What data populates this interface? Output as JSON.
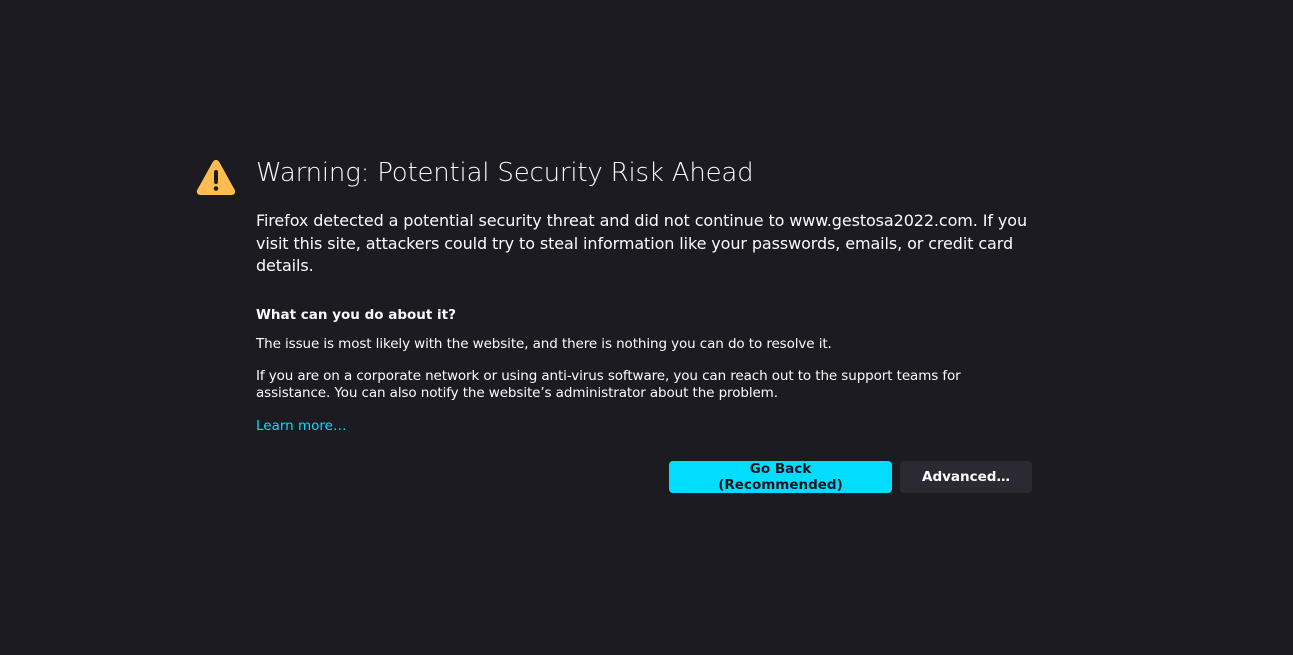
{
  "page": {
    "title": "Warning: Potential Security Risk Ahead",
    "intro": "Firefox detected a potential security threat and did not continue to www.gestosa2022.com. If you visit this site, attackers could try to steal information like your passwords, emails, or credit card details.",
    "subheading": "What can you do about it?",
    "paragraph_1": "The issue is most likely with the website, and there is nothing you can do to resolve it.",
    "paragraph_2": "If you are on a corporate network or using anti-virus software, you can reach out to the support teams for assistance. You can also notify the website’s administrator about the problem.",
    "learn_more": "Learn more…"
  },
  "buttons": {
    "go_back": "Go Back (Recommended)",
    "advanced": "Advanced…"
  },
  "icons": {
    "warning": "warning-triangle-icon"
  },
  "colors": {
    "background": "#1c1b22",
    "text": "#fbfbfe",
    "accent": "#00ddff",
    "warning": "#ffbd4f",
    "secondary_button": "#2b2a33"
  }
}
